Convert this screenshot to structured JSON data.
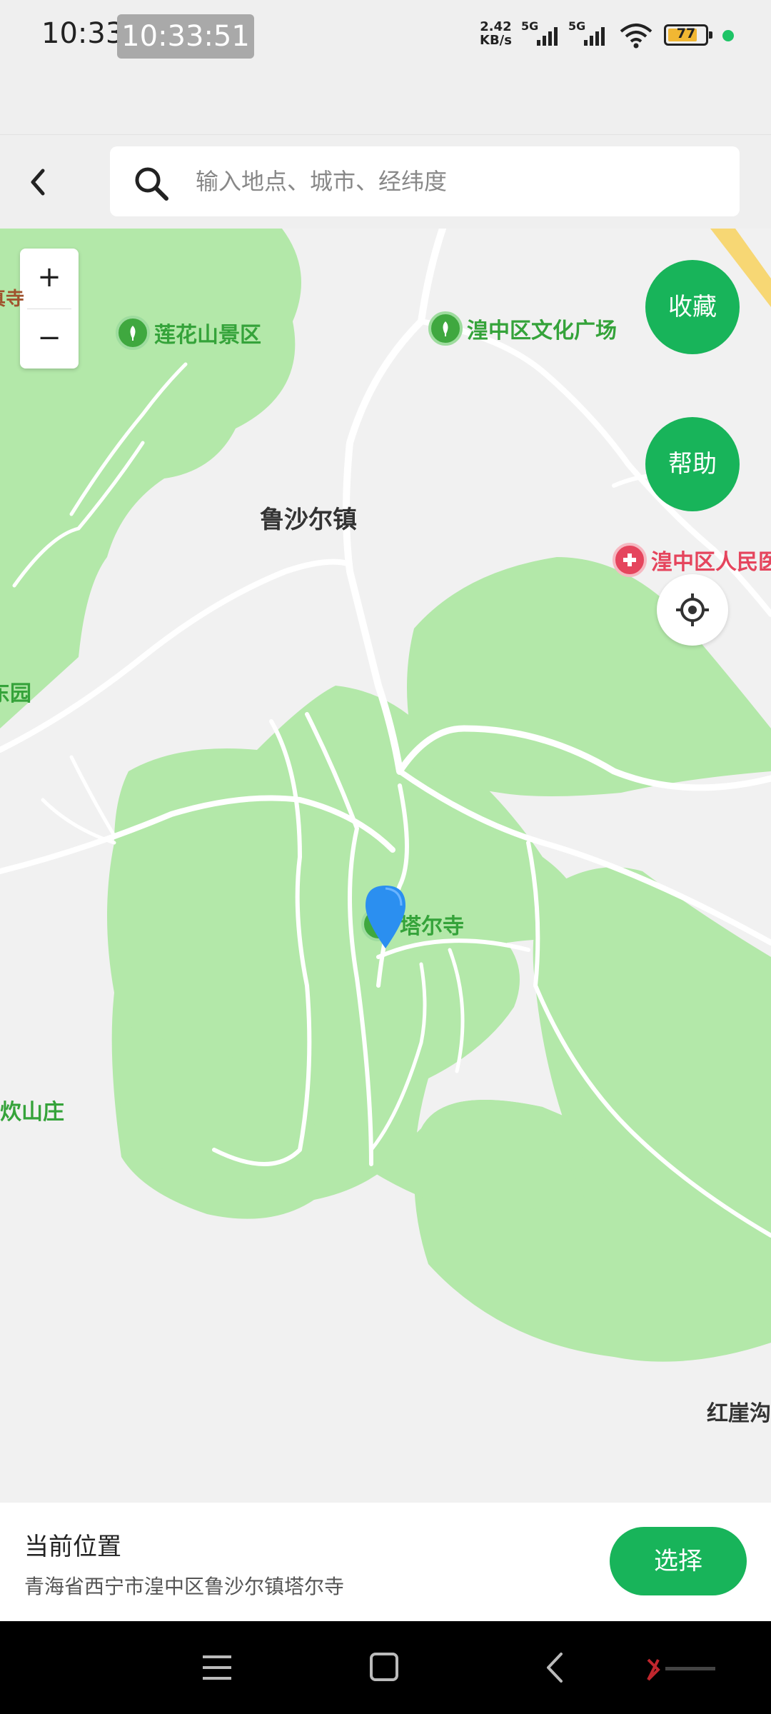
{
  "status_bar": {
    "time": "10:33",
    "clock_overlay": "10:33:51",
    "net_speed_value": "2.42",
    "net_speed_unit": "KB/s",
    "sim1": "5G",
    "sim2": "5G",
    "battery": "77",
    "battery_color": "#f1b733",
    "dot_color": "#1ec466"
  },
  "search": {
    "placeholder": "输入地点、城市、经纬度",
    "value": ""
  },
  "map": {
    "zoom_in": "+",
    "zoom_out": "−",
    "favorite_button": "收藏",
    "help_button": "帮助",
    "town_label": "鲁沙尔镇",
    "pois": {
      "lotus": "莲花山景区",
      "culture": "湟中区文化广场",
      "hospital": "湟中区人民医",
      "temple": "塔尔寺"
    },
    "edge_labels": {
      "left_top": "真寺",
      "left_mid": "东园",
      "left_low": "炊山庄",
      "right_low": "红崖沟"
    },
    "accent_color": "#18b45a",
    "park_color": "#b3e8a9"
  },
  "bottom_panel": {
    "title": "当前位置",
    "address": "青海省西宁市湟中区鲁沙尔镇塔尔寺",
    "select_button": "选择"
  },
  "nav_bar": {
    "icons": [
      "menu-icon",
      "home-icon",
      "back-icon"
    ]
  }
}
